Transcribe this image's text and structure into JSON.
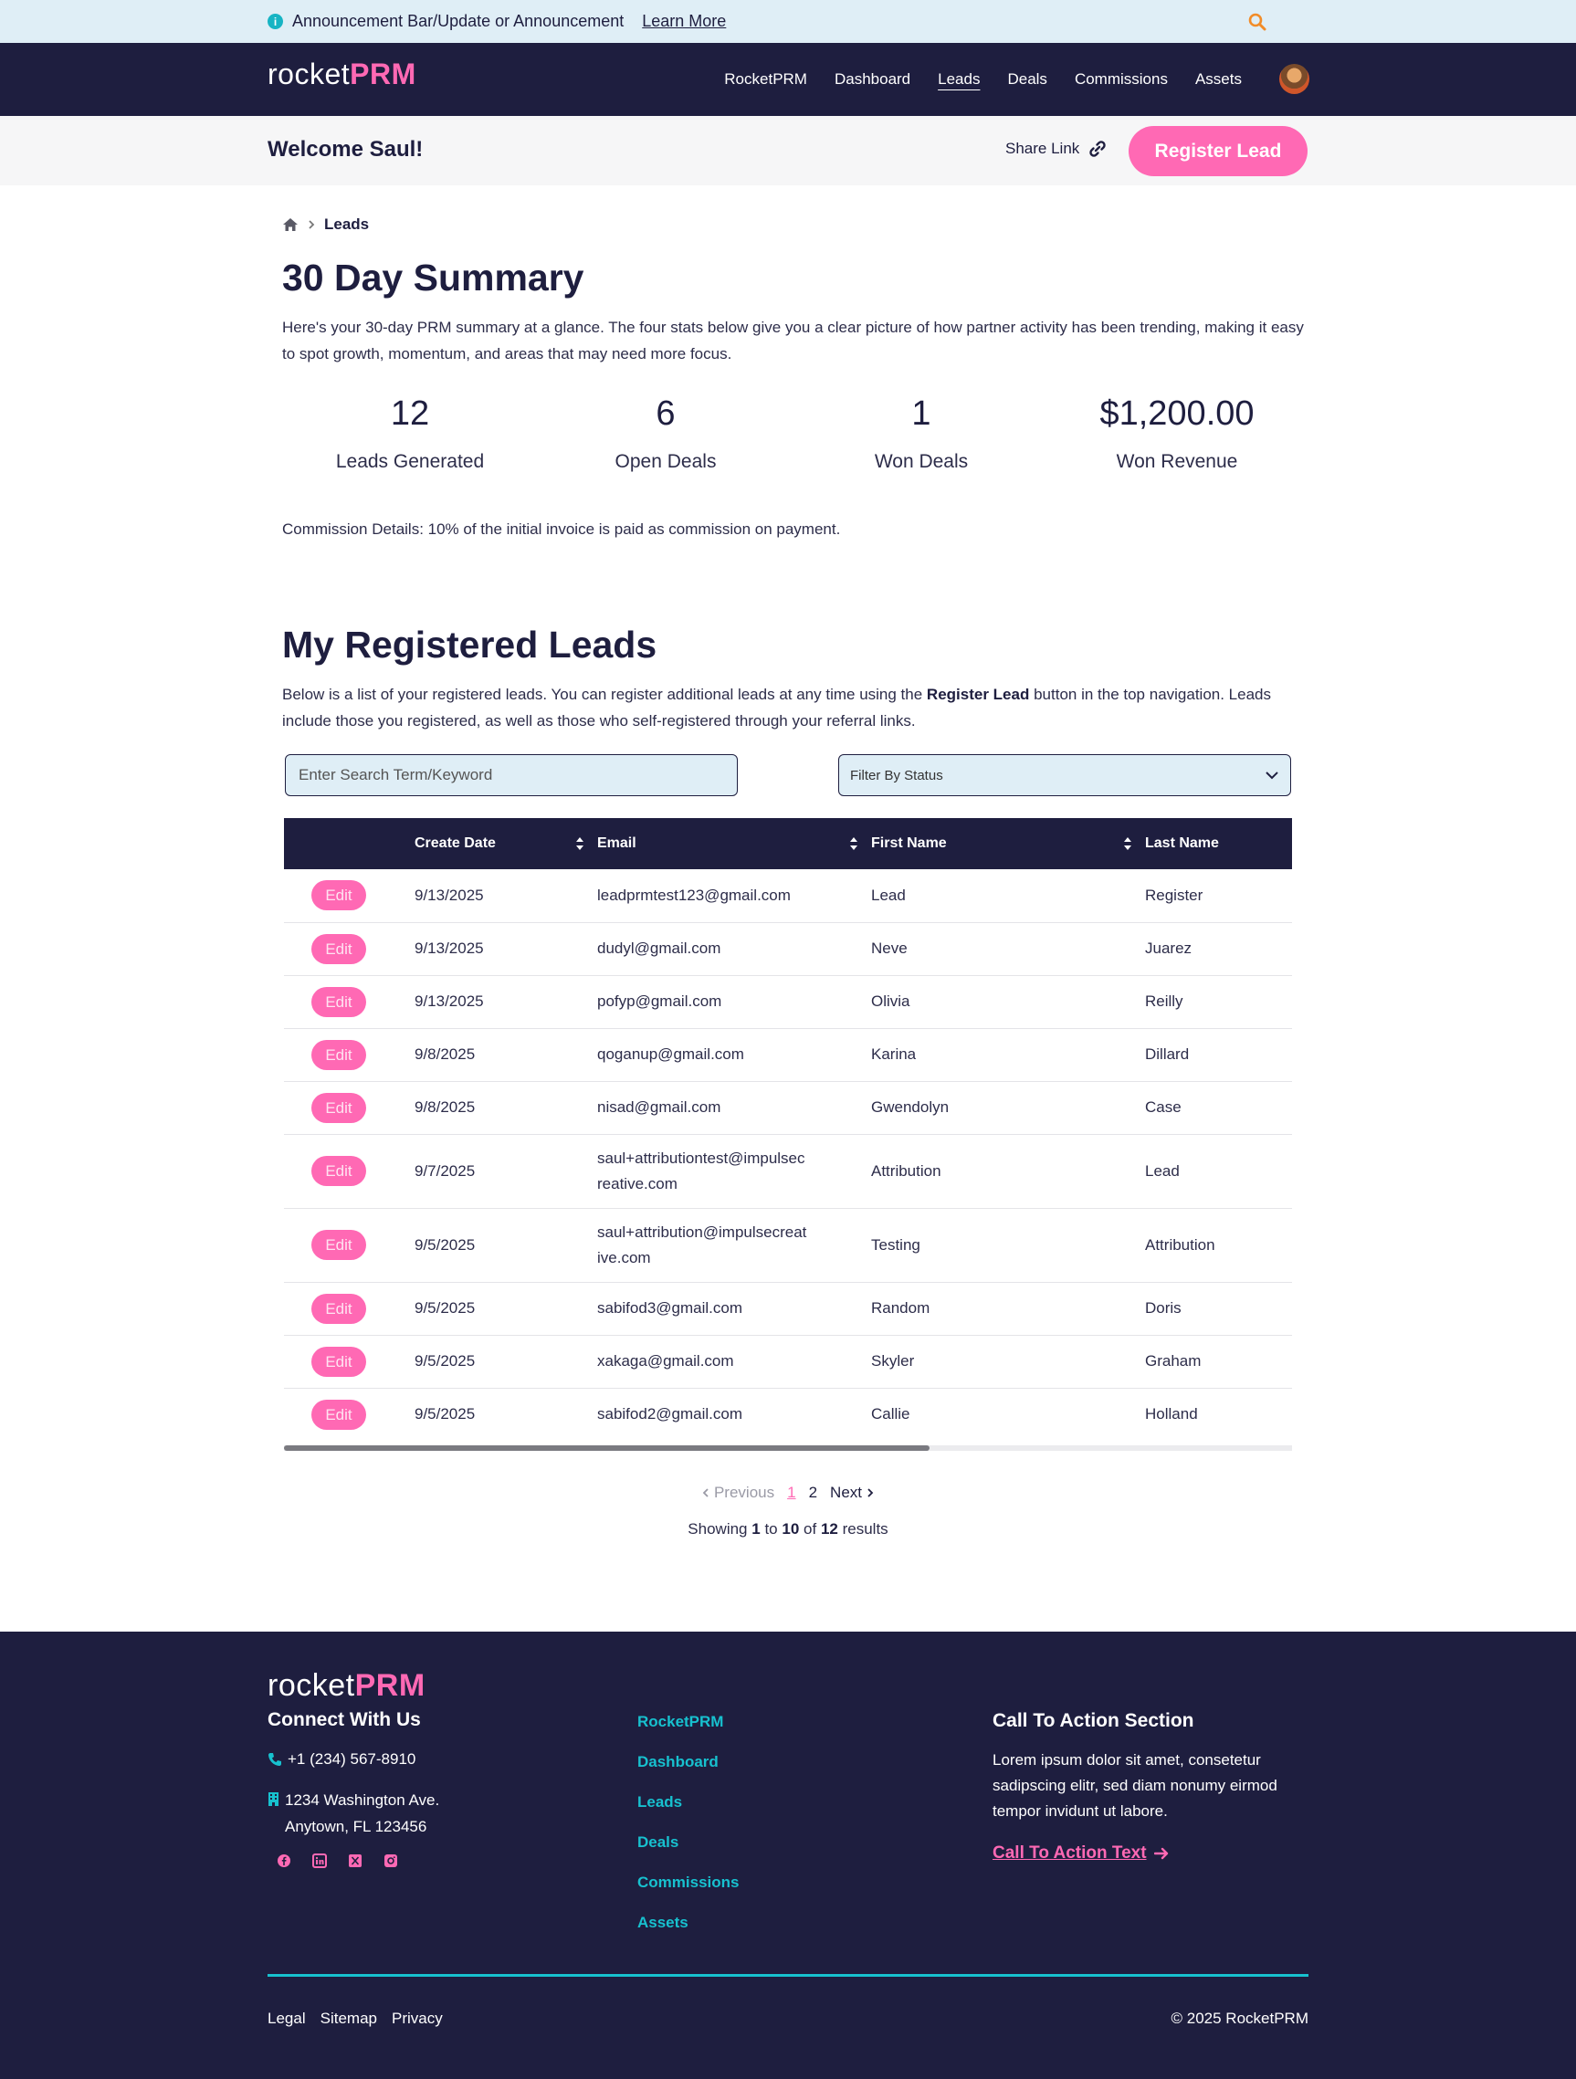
{
  "announcement": {
    "text": "Announcement Bar/Update or Announcement",
    "link": "Learn More"
  },
  "brand": {
    "logo_part1": "rocket",
    "logo_part2": "PRM",
    "accent": "#ff69b4",
    "navy": "#1e1e3f",
    "teal": "#17c1cf"
  },
  "nav": {
    "items": [
      "RocketPRM",
      "Dashboard",
      "Leads",
      "Deals",
      "Commissions",
      "Assets"
    ],
    "active": "Leads"
  },
  "welcome": {
    "title": "Welcome Saul!",
    "share_label": "Share Link",
    "register_label": "Register Lead"
  },
  "breadcrumb": {
    "current": "Leads"
  },
  "summary": {
    "title": "30 Day Summary",
    "intro": "Here's your 30-day PRM summary at a glance. The four stats below give you a clear picture of how partner activity has been trending, making it easy to spot growth, momentum, and areas that may need more focus.",
    "stats": [
      {
        "value": "12",
        "label": "Leads Generated"
      },
      {
        "value": "6",
        "label": "Open Deals"
      },
      {
        "value": "1",
        "label": "Won Deals"
      },
      {
        "value": "$1,200.00",
        "label": "Won Revenue"
      }
    ],
    "commission": "Commission Details: 10% of the initial invoice is paid as commission on payment."
  },
  "leads": {
    "title": "My Registered Leads",
    "intro_part1": "Below is a list of your registered leads. You can register additional leads at any time using the ",
    "intro_bold": "Register Lead",
    "intro_part2": " button in the top navigation. Leads include those you registered, as well as those who self-registered through your referral links.",
    "search_placeholder": "Enter Search Term/Keyword",
    "filter_label": "Filter By Status",
    "columns": [
      "Create Date",
      "Email",
      "First Name",
      "Last Name"
    ],
    "edit_label": "Edit",
    "rows": [
      {
        "date": "9/13/2025",
        "email": "leadprmtest123@gmail.com",
        "first": "Lead",
        "last": "Register"
      },
      {
        "date": "9/13/2025",
        "email": "dudyl@gmail.com",
        "first": "Neve",
        "last": "Juarez"
      },
      {
        "date": "9/13/2025",
        "email": "pofyp@gmail.com",
        "first": "Olivia",
        "last": "Reilly"
      },
      {
        "date": "9/8/2025",
        "email": "qoganup@gmail.com",
        "first": "Karina",
        "last": "Dillard"
      },
      {
        "date": "9/8/2025",
        "email": "nisad@gmail.com",
        "first": "Gwendolyn",
        "last": "Case"
      },
      {
        "date": "9/7/2025",
        "email_line1": "saul+attributiontest@impulsec",
        "email_line2": "reative.com",
        "first": "Attribution",
        "last": "Lead"
      },
      {
        "date": "9/5/2025",
        "email_line1": "saul+attribution@impulsecreat",
        "email_line2": "ive.com",
        "first": "Testing",
        "last": "Attribution"
      },
      {
        "date": "9/5/2025",
        "email": "sabifod3@gmail.com",
        "first": "Random",
        "last": "Doris"
      },
      {
        "date": "9/5/2025",
        "email": "xakaga@gmail.com",
        "first": "Skyler",
        "last": "Graham"
      },
      {
        "date": "9/5/2025",
        "email": "sabifod2@gmail.com",
        "first": "Callie",
        "last": "Holland"
      }
    ],
    "horizontal_scroll_fraction": 0.64
  },
  "pagination": {
    "previous": "Previous",
    "pages": [
      "1",
      "2"
    ],
    "current": "1",
    "next": "Next",
    "showing_prefix": "Showing",
    "from": "1",
    "to_word": "to",
    "to": "10",
    "of_word": "of",
    "total": "12",
    "suffix": "results"
  },
  "footer": {
    "connect_title": "Connect With Us",
    "phone": "+1 (234) 567-8910",
    "address_line1": "1234 Washington Ave.",
    "address_line2": "Anytown, FL 123456",
    "socials": [
      "facebook-icon",
      "linkedin-icon",
      "x-icon",
      "instagram-icon"
    ],
    "links": [
      "RocketPRM",
      "Dashboard",
      "Leads",
      "Deals",
      "Commissions",
      "Assets"
    ],
    "cta_title": "Call To Action Section",
    "cta_text": "Lorem ipsum dolor sit amet, consetetur sadipscing elitr, sed diam nonumy eirmod tempor invidunt ut labore.",
    "cta_link": "Call To Action Text",
    "legal_links": [
      "Legal",
      "Sitemap",
      "Privacy"
    ],
    "copyright": "© 2025 RocketPRM"
  }
}
